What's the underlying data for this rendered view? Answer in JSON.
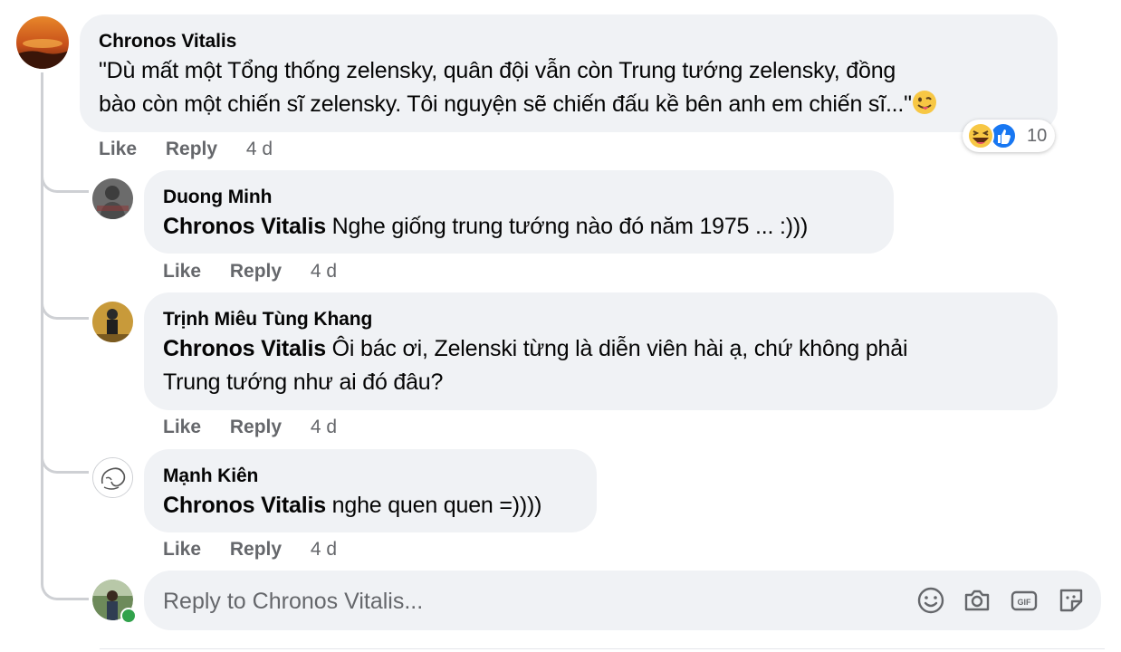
{
  "main_comment": {
    "author": "Chronos Vitalis",
    "text_line1": "\"Dù mất một Tổng thống zelensky, quân đội vẫn còn Trung tướng zelensky, đồng",
    "text_line2": "bào còn một chiến sĩ zelensky. Tôi nguyện sẽ chiến đấu kề bên anh em chiến sĩ...\"",
    "like": "Like",
    "reply": "Reply",
    "time": "4 d",
    "reaction_count": "10"
  },
  "replies": [
    {
      "author": "Duong Minh",
      "mention": "Chronos Vitalis",
      "text": "Nghe giống trung tướng nào đó năm 1975 ... :)))",
      "like": "Like",
      "reply": "Reply",
      "time": "4 d"
    },
    {
      "author": "Trịnh Miêu Tùng Khang",
      "mention": "Chronos Vitalis",
      "text_line1": "Ôi bác ơi, Zelenski từng là diễn viên hài ạ, chứ không phải",
      "text_line2": "Trung tướng như ai đó đâu?",
      "like": "Like",
      "reply": "Reply",
      "time": "4 d"
    },
    {
      "author": "Mạnh Kiên",
      "mention": "Chronos Vitalis",
      "text": "nghe quen quen =))))",
      "like": "Like",
      "reply": "Reply",
      "time": "4 d"
    }
  ],
  "reply_composer": {
    "placeholder": "Reply to Chronos Vitalis...",
    "icons": [
      "smiley-icon",
      "camera-icon",
      "gif-icon",
      "sticker-icon"
    ]
  },
  "colors": {
    "bubble": "#f0f2f5",
    "secondary_text": "#65676b",
    "online": "#31a24c",
    "like_blue": "#1877f2"
  }
}
